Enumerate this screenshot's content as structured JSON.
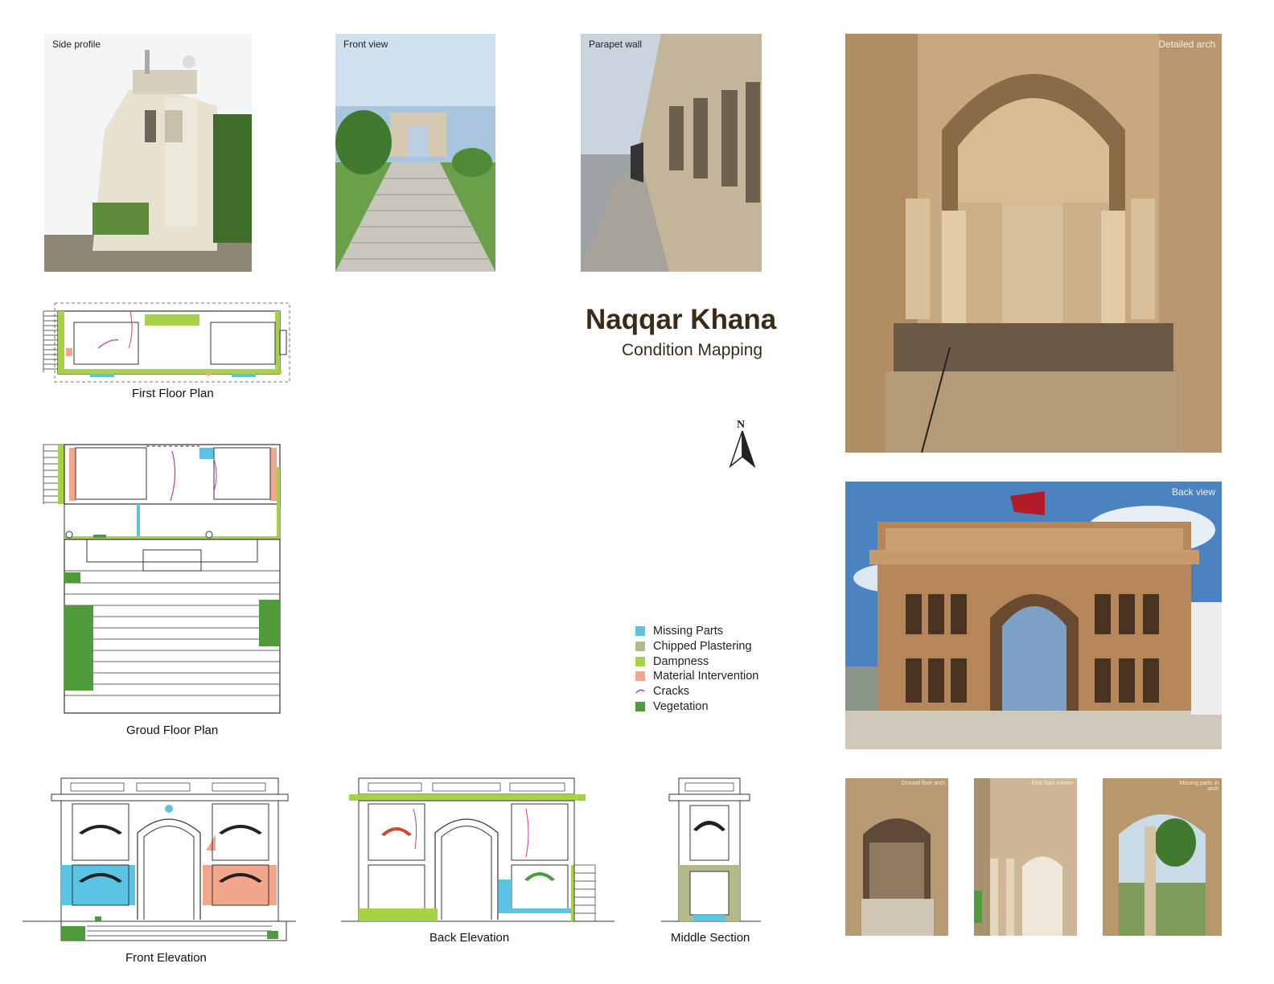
{
  "photos": {
    "side_profile": "Side profile",
    "front_view": "Front view",
    "parapet_wall": "Parapet wall",
    "detailed_arch": "Detailed arch",
    "back_view": "Back view",
    "ground_floor_arch": "Ground floor arch",
    "first_floor_interior": "First floor interior",
    "missing_parts_in_arch": "Missing parts in arch"
  },
  "title": "Naqqar Khana",
  "subtitle": "Condition Mapping",
  "north": "N",
  "drawings": {
    "first_floor_plan": "First Floor Plan",
    "ground_floor_plan": "Groud Floor Plan",
    "front_elevation": "Front Elevation",
    "back_elevation": "Back Elevation",
    "middle_section": "Middle Section"
  },
  "legend": [
    {
      "label": "Missing Parts",
      "color": "#5bc3e3",
      "kind": "box"
    },
    {
      "label": "Chipped Plastering",
      "color": "#b5b989",
      "kind": "box"
    },
    {
      "label": "Dampness",
      "color": "#a8d14a",
      "kind": "box"
    },
    {
      "label": "Material Intervention",
      "color": "#f3a68c",
      "kind": "box"
    },
    {
      "label": "Cracks",
      "color": "#c0399a",
      "kind": "line"
    },
    {
      "label": "Vegetation",
      "color": "#4f9a3a",
      "kind": "box"
    }
  ]
}
